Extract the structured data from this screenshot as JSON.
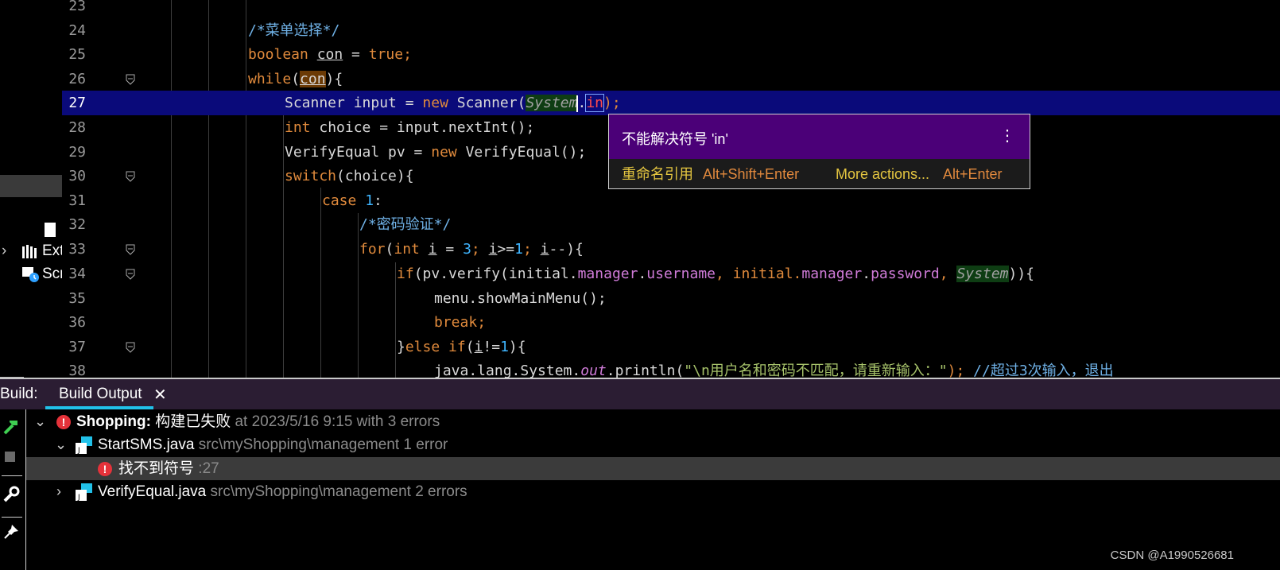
{
  "project": {
    "items": [
      {
        "label": "Ext",
        "icon": "library-icon"
      },
      {
        "label": "Scr",
        "icon": "scratches-icon"
      }
    ]
  },
  "editor": {
    "lines": [
      {
        "num": "23"
      },
      {
        "num": "24"
      },
      {
        "num": "25"
      },
      {
        "num": "26"
      },
      {
        "num": "27"
      },
      {
        "num": "28"
      },
      {
        "num": "29"
      },
      {
        "num": "30"
      },
      {
        "num": "31"
      },
      {
        "num": "32"
      },
      {
        "num": "33"
      },
      {
        "num": "34"
      },
      {
        "num": "35"
      },
      {
        "num": "36"
      },
      {
        "num": "37"
      },
      {
        "num": "38"
      }
    ],
    "code": {
      "l24_comment": "/*菜单选择*/",
      "l25_kw": "boolean",
      "l25_var": "con",
      "l25_eq": " = ",
      "l25_val": "true",
      "l25_end": ";",
      "l26_kw": "while",
      "l26_open": "(",
      "l26_var": "con",
      "l26_close": "){",
      "l27_a": "Scanner input = ",
      "l27_new": "new",
      "l27_b": " Scanner(",
      "l27_sys": "System",
      "l27_dot": ".",
      "l27_in": "in",
      "l27_end": ");",
      "l28_kw": "int",
      "l28_rest": " choice = input.nextInt();",
      "l29_a": "VerifyEqual pv = ",
      "l29_new": "new",
      "l29_b": " VerifyEqual();",
      "l30_kw": "switch",
      "l30_rest": "(choice){",
      "l31_kw": "case",
      "l31_sp": " ",
      "l31_num": "1",
      "l31_colon": ":",
      "l32_comment": "/*密码验证*/",
      "l33_for": "for",
      "l33_p1": "(",
      "l33_int": "int",
      "l33_sp": " ",
      "l33_i1": "i",
      "l33_eq": " = ",
      "l33_n3": "3",
      "l33_semi1": "; ",
      "l33_i2": "i",
      "l33_ge": ">=",
      "l33_n1": "1",
      "l33_semi2": "; ",
      "l33_i3": "i",
      "l33_end": "--){",
      "l34_if": "if",
      "l34_a": "(pv.verify(initial.",
      "l34_f1": "manager",
      "l34_d1": ".",
      "l34_f2": "username",
      "l34_c": ", initial.",
      "l34_f3": "manager",
      "l34_d2": ".",
      "l34_f4": "password",
      "l34_c2": ", ",
      "l34_sys": "System",
      "l34_end": ")){",
      "l35": "menu.showMainMenu();",
      "l36_kw": "break",
      "l36_end": ";",
      "l37_a": "}",
      "l37_else": "else if",
      "l37_b": "(",
      "l37_i": "i",
      "l37_ne": "!=",
      "l37_n": "1",
      "l37_c": "){",
      "l38_a": "java.lang.System.",
      "l38_out": "out",
      "l38_b": ".println(",
      "l38_str": "\"\\n用户名和密码不匹配，请重新输入：\"",
      "l38_c": "); ",
      "l38_comment": "//超过3次输入，退出"
    }
  },
  "popup": {
    "message": "不能解决符号 'in'",
    "rename_label": "重命名引用",
    "rename_shortcut": "Alt+Shift+Enter",
    "more_label": "More actions...",
    "more_shortcut": "Alt+Enter",
    "menu_icon": "kebab-menu-icon"
  },
  "build": {
    "label": "Build:",
    "tab_label": "Build Output",
    "close_glyph": "✕",
    "tree": {
      "root_name": "Shopping:",
      "root_status": " 构建已失败",
      "root_detail": " at 2023/5/16 9:15 with 3 errors",
      "file1_name": "StartSMS.java",
      "file1_detail": " src\\myShopping\\management 1 error",
      "error1_msg": "找不到符号",
      "error1_line": " :27",
      "file2_name": "VerifyEqual.java",
      "file2_detail": " src\\myShopping\\management 2 errors"
    }
  },
  "watermark": "CSDN @A1990526681",
  "colors": {
    "keyword": "#e08a3c",
    "comment": "#6fb1e6",
    "number": "#3fb5ff",
    "field": "#cf7bd8",
    "string": "#a6c26a",
    "current_line": "#0a0a7a",
    "popup_header": "#4b0078",
    "error_icon": "#e5323a",
    "tab_underline": "#21c1e9"
  }
}
